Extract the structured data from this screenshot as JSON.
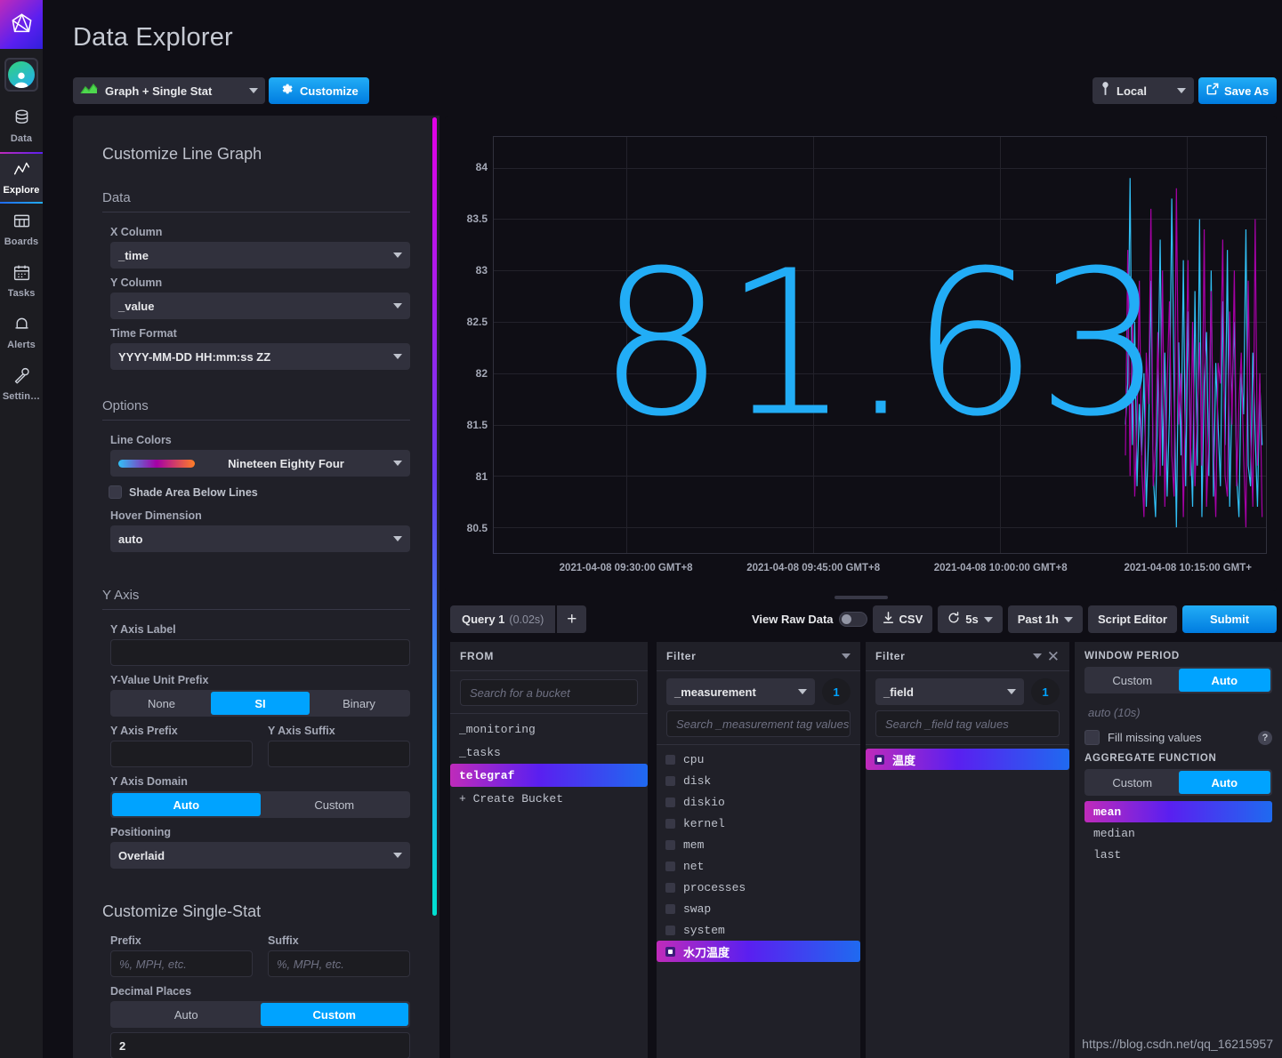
{
  "nav": {
    "logo_icon": "influx-logo-icon",
    "avatar_icon": "user-avatar-icon",
    "items": [
      {
        "label": "Data",
        "icon": "database-icon",
        "active": false
      },
      {
        "label": "Explore",
        "icon": "line-graph-icon",
        "active": true
      },
      {
        "label": "Boards",
        "icon": "dashboard-grid-icon",
        "active": false
      },
      {
        "label": "Tasks",
        "icon": "calendar-icon",
        "active": false
      },
      {
        "label": "Alerts",
        "icon": "bell-icon",
        "active": false
      },
      {
        "label": "Settin…",
        "icon": "wrench-icon",
        "active": false
      }
    ]
  },
  "header": {
    "title": "Data Explorer",
    "view_type": "Graph + Single Stat",
    "view_type_icon": "graph-single-stat-icon",
    "customize_label": "Customize",
    "customize_icon": "gear-icon",
    "local_label": "Local",
    "local_icon": "timezone-pin-icon",
    "save_as_label": "Save As",
    "save_as_icon": "export-icon"
  },
  "customize": {
    "title": "Customize Line Graph",
    "data_section": "Data",
    "x_column_label": "X Column",
    "x_column_value": "_time",
    "y_column_label": "Y Column",
    "y_column_value": "_value",
    "time_format_label": "Time Format",
    "time_format_value": "YYYY-MM-DD HH:mm:ss ZZ",
    "options_section": "Options",
    "line_colors_label": "Line Colors",
    "line_colors_value": "Nineteen Eighty Four",
    "shade_area_label": "Shade Area Below Lines",
    "shade_area_checked": false,
    "hover_dimension_label": "Hover Dimension",
    "hover_dimension_value": "auto",
    "y_axis_section": "Y Axis",
    "y_axis_label_label": "Y Axis Label",
    "y_axis_label_value": "",
    "y_unit_prefix_label": "Y-Value Unit Prefix",
    "y_unit_prefix_options": [
      "None",
      "SI",
      "Binary"
    ],
    "y_unit_prefix_selected": "SI",
    "y_axis_prefix_label": "Y Axis Prefix",
    "y_axis_prefix_value": "",
    "y_axis_suffix_label": "Y Axis Suffix",
    "y_axis_suffix_value": "",
    "y_axis_domain_label": "Y Axis Domain",
    "y_axis_domain_options": [
      "Auto",
      "Custom"
    ],
    "y_axis_domain_selected": "Auto",
    "positioning_label": "Positioning",
    "positioning_value": "Overlaid",
    "single_stat_title": "Customize Single-Stat",
    "prefix_label": "Prefix",
    "prefix_placeholder": "%, MPH, etc.",
    "suffix_label": "Suffix",
    "suffix_placeholder": "%, MPH, etc.",
    "decimal_places_label": "Decimal Places",
    "decimal_places_options": [
      "Auto",
      "Custom"
    ],
    "decimal_places_selected": "Custom",
    "decimal_places_value": "2"
  },
  "chart_data": {
    "type": "line",
    "title": "",
    "xlabel": "",
    "ylabel": "",
    "single_stat": "81.63",
    "single_stat_color": "#22adf6",
    "grid": true,
    "legend_position": "none",
    "ylim": [
      80.25,
      84.3
    ],
    "yticks": [
      84,
      83.5,
      83,
      82.5,
      82,
      81.5,
      81,
      80.5
    ],
    "ytick_labels": [
      "84",
      "83.5",
      "83",
      "82.5",
      "82",
      "81.5",
      "81",
      "80.5"
    ],
    "xticks": [
      0.172,
      0.414,
      0.656,
      0.898
    ],
    "xtick_labels": [
      "2021-04-08 09:30:00 GMT+8",
      "2021-04-08 09:45:00 GMT+8",
      "2021-04-08 10:00:00 GMT+8",
      "2021-04-08 10:15:00 GMT+"
    ],
    "series": [
      {
        "name": "series-cyan",
        "color": "#31c0f6",
        "x": [
          0.818,
          0.821,
          0.824,
          0.827,
          0.83,
          0.833,
          0.836,
          0.839,
          0.842,
          0.845,
          0.848,
          0.851,
          0.854,
          0.857,
          0.86,
          0.863,
          0.866,
          0.869,
          0.872,
          0.875,
          0.878,
          0.881,
          0.884,
          0.887,
          0.89,
          0.893,
          0.896,
          0.899,
          0.902,
          0.905,
          0.908,
          0.911,
          0.914,
          0.917,
          0.92,
          0.923,
          0.926,
          0.929,
          0.932,
          0.935,
          0.938,
          0.941,
          0.944,
          0.947,
          0.95,
          0.953,
          0.956,
          0.959,
          0.962,
          0.965,
          0.968,
          0.971,
          0.974,
          0.977,
          0.98,
          0.983,
          0.986,
          0.989,
          0.992,
          0.995
        ],
        "values": [
          81.5,
          81.9,
          83.9,
          81.3,
          82.5,
          80.9,
          81.7,
          81.2,
          82.0,
          80.7,
          81.4,
          82.9,
          81.0,
          80.6,
          81.8,
          83.3,
          81.1,
          82.2,
          80.8,
          81.6,
          83.7,
          81.9,
          80.5,
          82.3,
          81.2,
          83.1,
          80.9,
          82.6,
          81.4,
          80.7,
          82.8,
          81.1,
          83.5,
          80.6,
          81.9,
          82.4,
          81.0,
          83.0,
          80.8,
          82.1,
          81.5,
          80.9,
          82.7,
          81.3,
          83.2,
          80.7,
          81.8,
          82.5,
          81.0,
          80.6,
          82.0,
          81.6,
          83.4,
          81.1,
          80.9,
          82.2,
          81.4,
          80.7,
          81.9,
          81.3
        ]
      },
      {
        "name": "series-magenta",
        "color": "#a500a5",
        "x": [
          0.818,
          0.821,
          0.824,
          0.827,
          0.83,
          0.833,
          0.836,
          0.839,
          0.842,
          0.845,
          0.848,
          0.851,
          0.854,
          0.857,
          0.86,
          0.863,
          0.866,
          0.869,
          0.872,
          0.875,
          0.878,
          0.881,
          0.884,
          0.887,
          0.89,
          0.893,
          0.896,
          0.899,
          0.902,
          0.905,
          0.908,
          0.911,
          0.914,
          0.917,
          0.92,
          0.923,
          0.926,
          0.929,
          0.932,
          0.935,
          0.938,
          0.941,
          0.944,
          0.947,
          0.95,
          0.953,
          0.956,
          0.959,
          0.962,
          0.965,
          0.968,
          0.971,
          0.974,
          0.977,
          0.98,
          0.983,
          0.986,
          0.989,
          0.992,
          0.995
        ],
        "values": [
          81.2,
          83.2,
          81.0,
          82.6,
          80.8,
          81.5,
          82.9,
          81.1,
          80.6,
          82.2,
          81.7,
          83.6,
          80.9,
          81.3,
          82.4,
          81.0,
          83.0,
          80.7,
          81.9,
          82.7,
          81.2,
          80.8,
          83.8,
          81.5,
          82.0,
          80.6,
          81.8,
          83.1,
          81.0,
          82.5,
          80.9,
          81.6,
          82.3,
          81.1,
          83.4,
          80.7,
          81.4,
          82.8,
          81.3,
          80.6,
          82.1,
          81.9,
          83.3,
          81.0,
          80.8,
          82.6,
          81.5,
          83.0,
          80.9,
          81.7,
          82.2,
          81.2,
          80.5,
          82.9,
          81.4,
          80.7,
          83.5,
          81.1,
          82.0,
          80.6
        ]
      }
    ]
  },
  "query_toolbar": {
    "query_tab_name": "Query 1",
    "query_tab_time": "(0.02s)",
    "add_query_label": "+",
    "view_raw_data_label": "View Raw Data",
    "view_raw_data_on": false,
    "csv_label": "CSV",
    "csv_icon": "download-icon",
    "refresh_value": "5s",
    "refresh_icon": "refresh-icon",
    "time_range": "Past 1h",
    "script_editor_label": "Script Editor",
    "submit_label": "Submit"
  },
  "from_card": {
    "header": "FROM",
    "search_placeholder": "Search for a bucket",
    "items": [
      {
        "label": "_monitoring",
        "selected": false
      },
      {
        "label": "_tasks",
        "selected": false
      },
      {
        "label": "telegraf",
        "selected": true
      }
    ],
    "create_label": "+ Create Bucket"
  },
  "measurement_card": {
    "header": "Filter",
    "key": "_measurement",
    "count": "1",
    "search_placeholder": "Search _measurement tag values",
    "items": [
      {
        "label": "cpu",
        "selected": false
      },
      {
        "label": "disk",
        "selected": false
      },
      {
        "label": "diskio",
        "selected": false
      },
      {
        "label": "kernel",
        "selected": false
      },
      {
        "label": "mem",
        "selected": false
      },
      {
        "label": "net",
        "selected": false
      },
      {
        "label": "processes",
        "selected": false
      },
      {
        "label": "swap",
        "selected": false
      },
      {
        "label": "system",
        "selected": false
      },
      {
        "label": "水刀温度",
        "selected": true
      }
    ]
  },
  "field_card": {
    "header": "Filter",
    "key": "_field",
    "count": "1",
    "search_placeholder": "Search _field tag values",
    "close_icon": "close-icon",
    "items": [
      {
        "label": "温度",
        "selected": true
      }
    ]
  },
  "window_card": {
    "window_period_header": "WINDOW PERIOD",
    "window_options": [
      "Custom",
      "Auto"
    ],
    "window_selected": "Auto",
    "window_value_placeholder": "auto (10s)",
    "fill_missing_label": "Fill missing values",
    "fill_missing_checked": false,
    "help_icon": "help-icon",
    "aggregate_header": "AGGREGATE FUNCTION",
    "aggregate_options": [
      "Custom",
      "Auto"
    ],
    "aggregate_selected": "Auto",
    "functions": [
      {
        "label": "mean",
        "selected": true
      },
      {
        "label": "median",
        "selected": false
      },
      {
        "label": "last",
        "selected": false
      }
    ]
  },
  "watermark": "https://blog.csdn.net/qq_16215957"
}
